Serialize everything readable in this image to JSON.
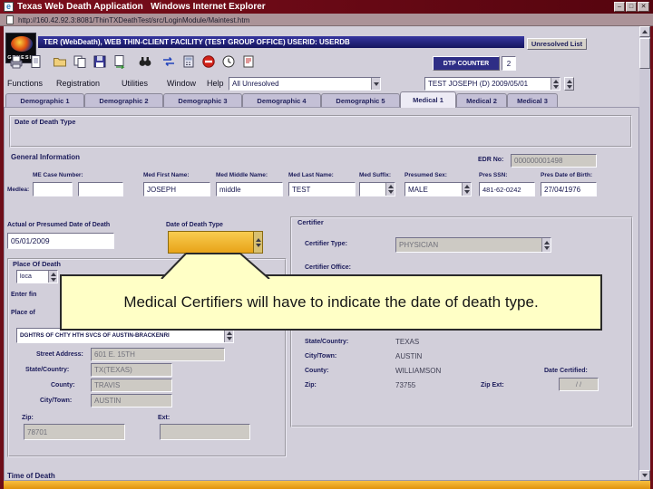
{
  "titlebar": {
    "title": "Texas Web Death Application   Windows Internet Explorer"
  },
  "addressbar": {
    "url": "http://160.42.92.3:8081/ThinTXDeathTest/src/LoginModule/Maintest.htm"
  },
  "header": {
    "logo_text": "GENESIS",
    "banner": "TER (WebDeath), WEB THIN-CLIENT FACILITY (TEST GROUP OFFICE) USERID: USERDB",
    "unresolved_list_button": "Unresolved List",
    "dtp_counter_label": "DTP COUNTER",
    "dtp_counter_value": "2"
  },
  "toolbar": {
    "icons": [
      "print-icon",
      "new-document-icon",
      "open-folder-icon",
      "copy-icon",
      "save-icon",
      "document-export-icon",
      "binoculars-search-icon",
      "transfer-icon",
      "calculator-icon",
      "stop-icon",
      "clock-icon",
      "notes-icon"
    ]
  },
  "menubar": {
    "items": [
      "Functions",
      "Registration",
      "Utilities",
      "Window",
      "Help"
    ],
    "filter_value": "All Unresolved",
    "record_value": "TEST JOSEPH (D) 2009/05/01"
  },
  "tabs": {
    "items": [
      {
        "label": "Demographic 1",
        "active": false
      },
      {
        "label": "Demographic 2",
        "active": false
      },
      {
        "label": "Demographic 3",
        "active": false
      },
      {
        "label": "Demographic 4",
        "active": false
      },
      {
        "label": "Demographic 5",
        "active": false
      },
      {
        "label": "Medical 1",
        "active": true
      },
      {
        "label": "Medical 2",
        "active": false
      },
      {
        "label": "Medical 3",
        "active": false
      }
    ]
  },
  "form": {
    "dod_type_group_label": "Date of Death Type",
    "general": {
      "section_label": "General Information",
      "edr_label": "EDR No:",
      "edr_value": "000000001498",
      "me_case_label": "ME Case Number:",
      "med_lic_label": "Medlea:",
      "first_label": "Med First Name:",
      "first_value": "JOSEPH",
      "middle_label": "Med Middle Name:",
      "middle_value": "middle",
      "last_label": "Med Last Name:",
      "last_value": "TEST",
      "suffix_label": "Med Suffix:",
      "sex_label": "Presumed Sex:",
      "sex_value": "MALE",
      "ssn_label": "Pres SSN:",
      "ssn_value": "481-62-0242",
      "dob_label": "Pres Date of Birth:",
      "dob_value": "27/04/1976"
    },
    "dod": {
      "actual_label": "Actual or Presumed Date of Death",
      "type_label": "Date of Death Type",
      "date_value": "05/01/2009"
    },
    "certifier": {
      "group_label": "Certifier",
      "type_label": "Certifier Type:",
      "type_value": "PHYSICIAN",
      "office_label": "Certifier Office:",
      "state_label": "State/Country:",
      "state_value": "TEXAS",
      "city_label": "City/Town:",
      "city_value": "AUSTIN",
      "county_label": "County:",
      "county_value": "WILLIAMSON",
      "zip_label": "Zip:",
      "zip_value": "73755",
      "zip_ext_label": "Zip Ext:",
      "date_cert_label": "Date Certified:",
      "date_cert_value": "/ /"
    },
    "place": {
      "group_label": "Place Of Death",
      "location_value": "loca",
      "enter_label": "Enter fin",
      "place_of_label": "Place of",
      "facility_value": "DGHTRS OF CHTY HTH SVCS OF AUSTIN-BRACKENRI",
      "street_label": "Street Address:",
      "street_value": "601 E. 15TH",
      "state_label": "State/Country:",
      "state_value": "TX(TEXAS)",
      "county_label": "County:",
      "county_value": "TRAVIS",
      "city_label": "City/Town:",
      "city_value": "AUSTIN",
      "zip_label": "Zip:",
      "zip_value": "78701",
      "ext_label": "Ext:"
    },
    "time_of_death_label": "Time of Death"
  },
  "callout": {
    "text": "Medical Certifiers will have to indicate the date of death type."
  }
}
